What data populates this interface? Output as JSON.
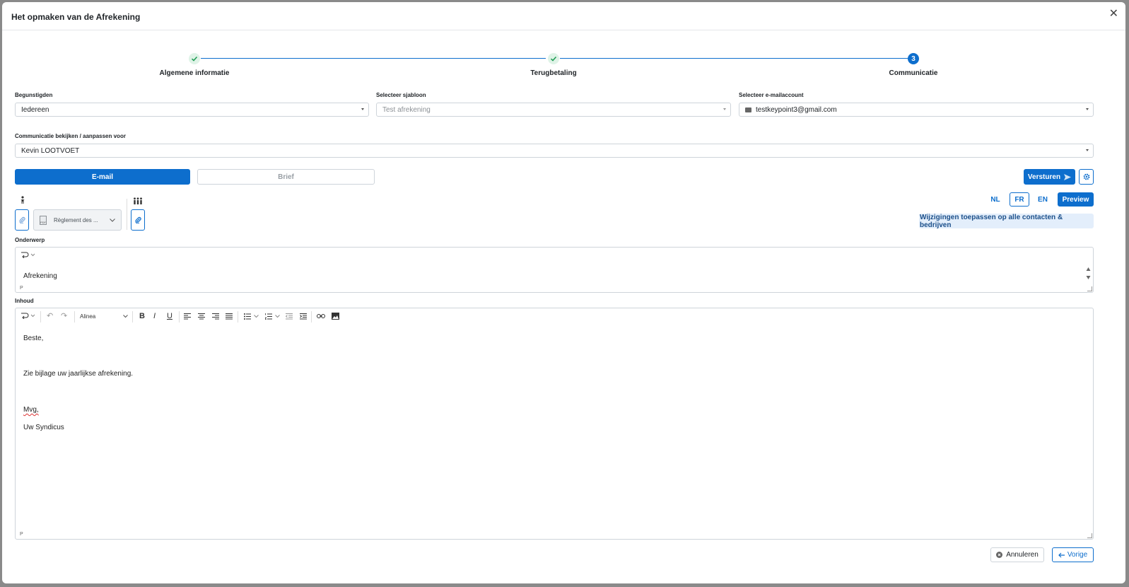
{
  "modal": {
    "title": "Het opmaken van de Afrekening"
  },
  "stepper": {
    "steps": [
      {
        "label": "Algemene informatie",
        "state": "done"
      },
      {
        "label": "Terugbetaling",
        "state": "done"
      },
      {
        "label": "Communicatie",
        "state": "active",
        "number": "3"
      }
    ]
  },
  "form": {
    "beneficiaries": {
      "label": "Begunstigden",
      "value": "Iedereen"
    },
    "template": {
      "label": "Selecteer sjabloon",
      "value": "Test afrekening"
    },
    "email_account": {
      "label": "Selecteer e-mailaccount",
      "value": "testkeypoint3@gmail.com"
    },
    "view_for": {
      "label": "Communicatie bekijken / aanpassen voor",
      "value": "Kevin LOOTVOET"
    }
  },
  "channel_tabs": {
    "email": "E-mail",
    "letter": "Brief"
  },
  "actions": {
    "send": "Versturen",
    "apply_all": "Wijzigingen toepassen op alle contacten & bedrijven",
    "preview": "Preview"
  },
  "languages": [
    "NL",
    "FR",
    "EN"
  ],
  "selected_language": "FR",
  "attachment": {
    "name": "Règlement des ...",
    "type": "PDF"
  },
  "subject": {
    "label": "Onderwerp",
    "value": "Afrekening",
    "p_marker": "P"
  },
  "body": {
    "label": "Inhoud",
    "format": "Alinea",
    "lines": [
      "Beste,",
      "Zie bijlage uw jaarlijkse afrekening.",
      "Mvg,",
      "Uw Syndicus"
    ],
    "p_marker": "P"
  },
  "footer": {
    "cancel": "Annuleren",
    "previous": "Vorige"
  },
  "colors": {
    "primary": "#0d6ecd",
    "success_check": "#1f9d55",
    "light_blue": "#e3eefb"
  }
}
